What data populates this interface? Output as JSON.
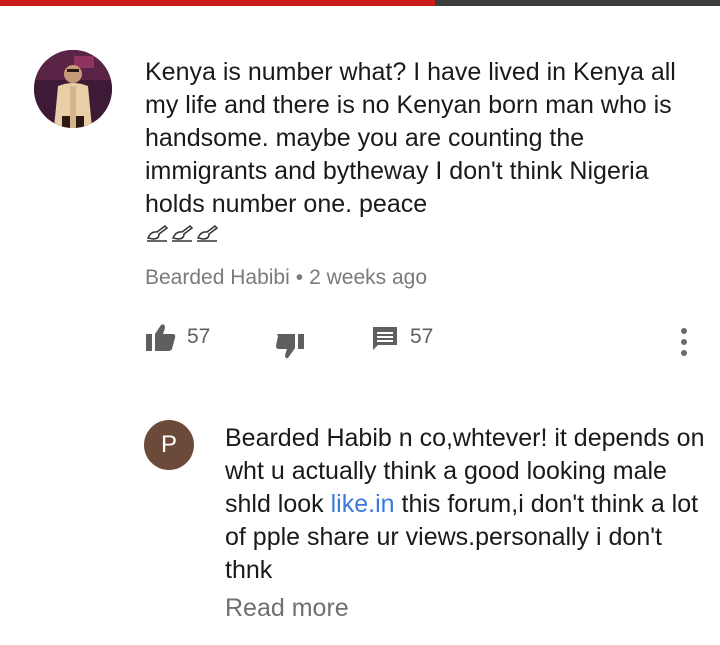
{
  "comment": {
    "text": "Kenya is number what? I have lived in Kenya all my life and there is no Kenyan born man who is handsome.  maybe you are counting the immigrants and bytheway I don't think Nigeria holds number one. peace",
    "emoji": "✍✍✍",
    "author": "Bearded Habibi",
    "separator": "•",
    "time": "2 weeks ago",
    "likes": "57",
    "replies": "57"
  },
  "reply": {
    "avatar_letter": "P",
    "text_before_link": "Bearded Habib n co,whtever! it depends on wht u actually think a good looking male shld look ",
    "link_text": "like.in",
    "text_after_link": " this forum,i don't think a lot of pple share ur views.personally i don't thnk",
    "read_more": "Read more"
  },
  "colors": {
    "text": "#1a1a1a",
    "meta": "#7a7a7a",
    "link": "#3a7ad8",
    "reply_avatar": "#6b4a3a"
  },
  "icons": [
    "thumbs-up-icon",
    "thumbs-down-icon",
    "comment-icon",
    "more-vert-icon",
    "writing-hand-icon"
  ]
}
